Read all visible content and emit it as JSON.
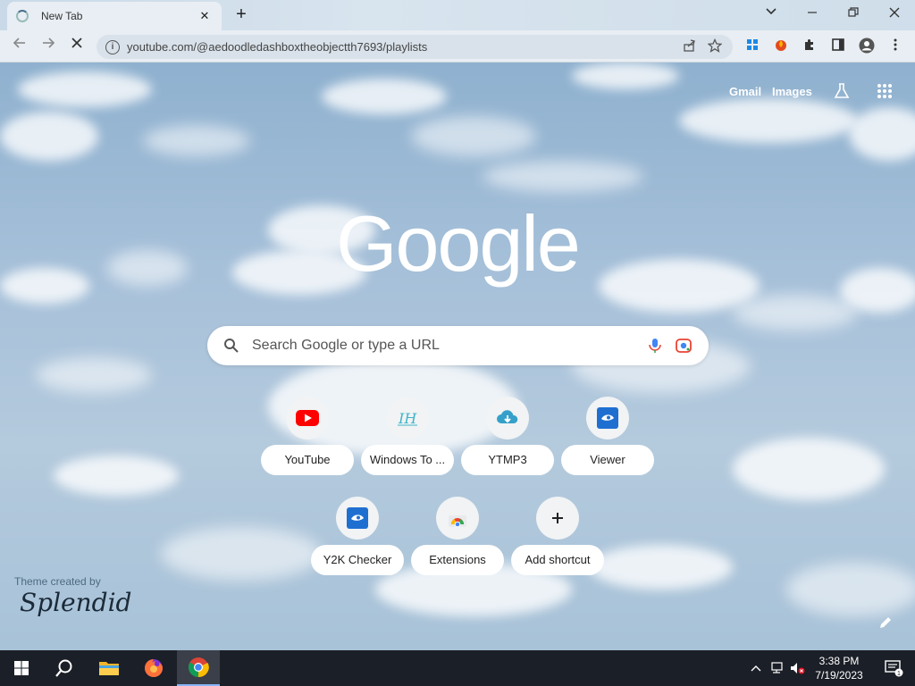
{
  "browser": {
    "tab_title": "New Tab",
    "tab_close": "✕",
    "new_tab": "+",
    "window_controls": {
      "tab_search": "⌄",
      "minimize": "—",
      "restore": "❐",
      "close": "✕"
    },
    "url": "youtube.com/@aedoodledashboxtheobjectth7693/playlists",
    "nav": {
      "back": "←",
      "forward": "→",
      "stop": "✕"
    }
  },
  "page": {
    "top_links": {
      "gmail": "Gmail",
      "images": "Images"
    },
    "logo": "Google",
    "search_placeholder": "Search Google or type a URL",
    "shortcuts": [
      {
        "label": "YouTube",
        "icon": "youtube-icon"
      },
      {
        "label": "Windows To ...",
        "icon": "ih-icon"
      },
      {
        "label": "YTMP3",
        "icon": "cloud-download-icon"
      },
      {
        "label": "Viewer",
        "icon": "viewer-icon"
      },
      {
        "label": "Y2K Checker",
        "icon": "viewer-icon"
      },
      {
        "label": "Extensions",
        "icon": "chrome-web-store-icon"
      },
      {
        "label": "Add shortcut",
        "icon": "plus-icon"
      }
    ],
    "theme_credit": "Theme created by",
    "theme_author": "Splendid"
  },
  "taskbar": {
    "time": "3:38 PM",
    "date": "7/19/2023",
    "notification_count": "1"
  },
  "colors": {
    "youtube_red": "#ff0000",
    "viewer_blue": "#1f6fd1",
    "ih_teal": "#3fb5c9"
  }
}
